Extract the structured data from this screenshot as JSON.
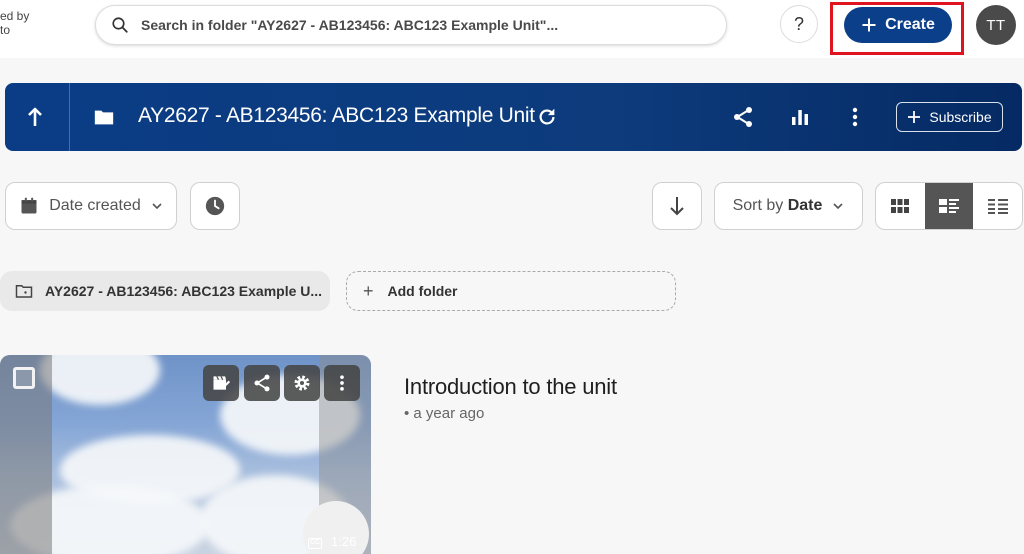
{
  "brand": {
    "line1": "ed by",
    "line2": "to"
  },
  "search": {
    "placeholder": "Search in folder \"AY2627 - AB123456: ABC123 Example Unit\"..."
  },
  "header_actions": {
    "help_label": "?",
    "create_label": "Create",
    "avatar_initials": "TT"
  },
  "folder": {
    "title": "AY2627 - AB123456: ABC123 Example Unit",
    "subscribe_label": "Subscribe"
  },
  "filters": {
    "date_filter_label": "Date created",
    "sort_prefix": "Sort by",
    "sort_value": "Date"
  },
  "subfolders": {
    "current_folder_label": "AY2627 - AB123456: ABC123 Example U...",
    "add_folder_label": "Add folder"
  },
  "videos": [
    {
      "title": "Introduction to the unit",
      "meta": "• a year ago",
      "duration": "1:26",
      "cc_label": "CC"
    }
  ],
  "colors": {
    "brand_blue": "#0b3f8a",
    "highlight_red": "#e0141e",
    "avatar_grey": "#4a4a4a"
  },
  "icons": {
    "search": "search-icon",
    "up": "arrow-up-icon",
    "folder": "folder-icon",
    "refresh": "refresh-icon",
    "share": "share-icon",
    "stats": "bar-chart-icon",
    "more": "more-vertical-icon",
    "calendar": "calendar-icon",
    "history": "clock-icon",
    "sort_direction": "arrow-down-icon",
    "grid_view": "grid-view-icon",
    "detail_view": "detail-view-icon",
    "list_view": "list-view-icon"
  }
}
